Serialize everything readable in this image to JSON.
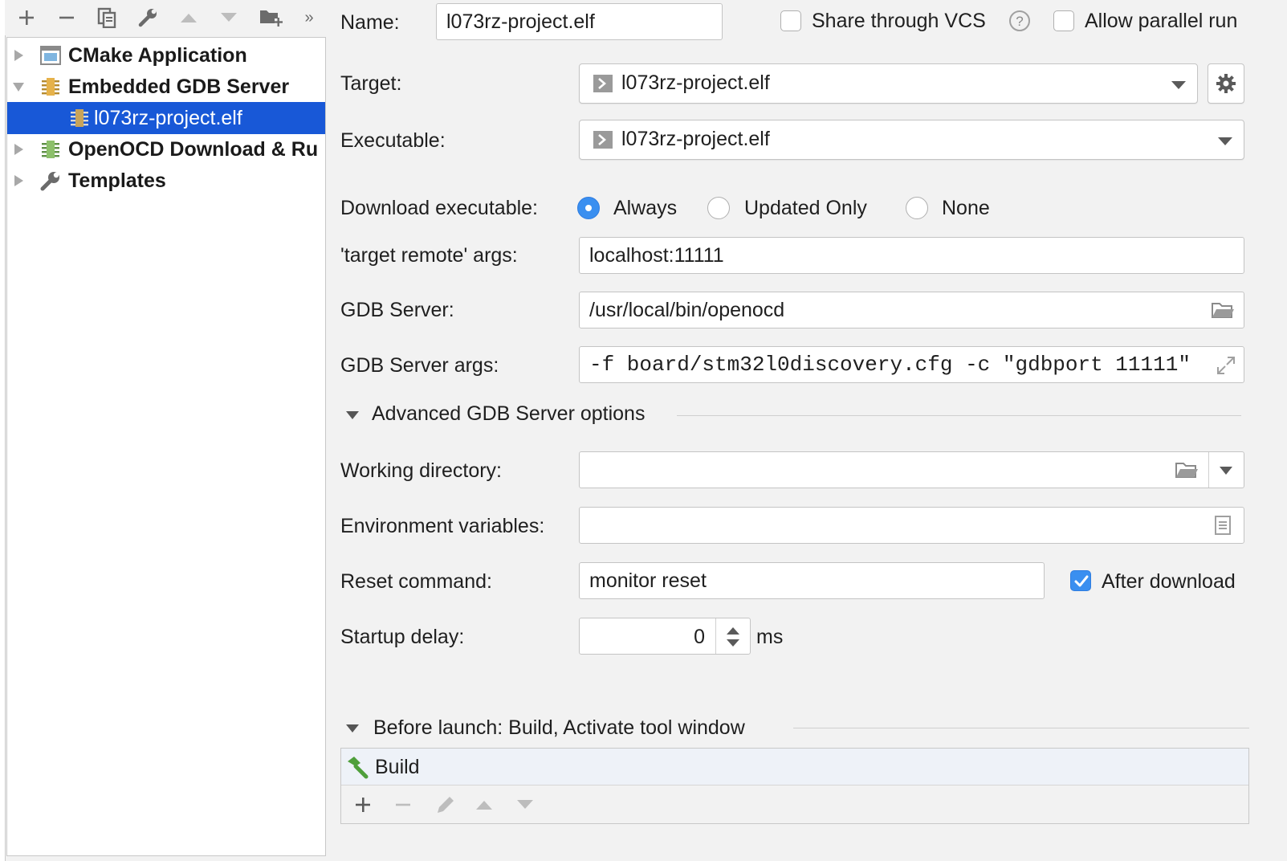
{
  "toolbar": {
    "icons": [
      "add-icon",
      "remove-icon",
      "copy-icon",
      "wrench-icon",
      "arrow-up-icon",
      "arrow-down-icon",
      "folder-add-icon",
      "more-icon"
    ],
    "more_label": "»"
  },
  "tree": {
    "items": [
      {
        "label": "CMake Application",
        "expanded": false,
        "icon": "cmake-app-icon"
      },
      {
        "label": "Embedded GDB Server",
        "expanded": true,
        "icon": "gdb-server-icon"
      },
      {
        "label": "l073rz-project.elf",
        "selected": true,
        "icon": "gdb-config-icon"
      },
      {
        "label": "OpenOCD Download & Ru",
        "expanded": false,
        "icon": "openocd-icon"
      },
      {
        "label": "Templates",
        "expanded": false,
        "icon": "wrench-icon"
      }
    ]
  },
  "form": {
    "name_label": "Name:",
    "name_value": "l073rz-project.elf",
    "share_vcs_label": "Share through VCS",
    "share_vcs_checked": false,
    "allow_parallel_label": "Allow parallel run",
    "allow_parallel_checked": false,
    "target_label": "Target:",
    "target_value": "l073rz-project.elf",
    "executable_label": "Executable:",
    "executable_value": "l073rz-project.elf",
    "download_label": "Download executable:",
    "download_options": [
      "Always",
      "Updated Only",
      "None"
    ],
    "download_selected": "Always",
    "target_remote_label": "'target remote' args:",
    "target_remote_value": "localhost:11111",
    "gdb_server_label": "GDB Server:",
    "gdb_server_value": "/usr/local/bin/openocd",
    "gdb_server_args_label": "GDB Server args:",
    "gdb_server_args_value": "-f board/stm32l0discovery.cfg -c \"gdbport 11111\"",
    "advanced_label": "Advanced GDB Server options",
    "working_dir_label": "Working directory:",
    "working_dir_value": "",
    "env_vars_label": "Environment variables:",
    "env_vars_value": "",
    "reset_cmd_label": "Reset command:",
    "reset_cmd_value": "monitor reset",
    "after_download_label": "After download",
    "after_download_checked": true,
    "startup_delay_label": "Startup delay:",
    "startup_delay_value": "0",
    "startup_delay_unit": "ms"
  },
  "before_launch": {
    "title": "Before launch: Build, Activate tool window",
    "tasks": [
      "Build"
    ],
    "toolbar_icons": [
      "add-icon",
      "remove-icon",
      "edit-icon",
      "arrow-up-icon",
      "arrow-down-icon"
    ]
  },
  "colors": {
    "selection": "#1858d7",
    "accent": "#3a8ff0",
    "panel_bg": "#f2f2f2"
  }
}
